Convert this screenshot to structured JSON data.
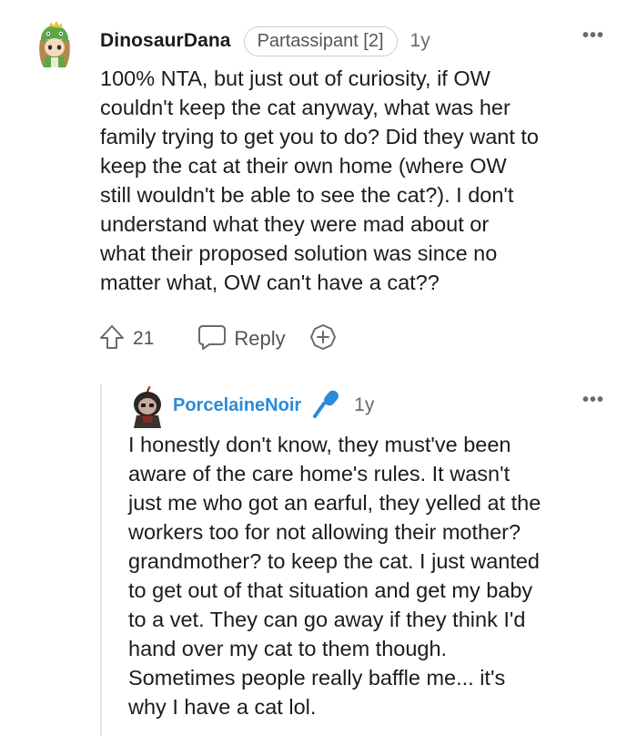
{
  "comment": {
    "username": "DinosaurDana",
    "flair": "Partassipant [2]",
    "age": "1y",
    "more": "•••",
    "body": "100% NTA, but just out of curiosity, if OW\ncouldn't keep the cat anyway, what was her\nfamily trying to get you to do? Did they want to\nkeep the cat at their own home (where OW\nstill wouldn't be able to see the cat?). I don't\nunderstand what they were mad about or\nwhat their proposed solution was since no\nmatter what, OW can't have a cat??",
    "upvotes": "21",
    "reply_label": "Reply",
    "icons": {
      "upvote": "upvote-arrow-icon",
      "reply": "speech-bubble-icon",
      "award": "plus-award-icon"
    }
  },
  "reply": {
    "username": "PorcelaineNoir",
    "age": "1y",
    "more": "•••",
    "body": "I honestly don't know, they must've been\naware of the care home's rules. It wasn't\njust me who got an earful, they yelled at the\nworkers too for not allowing their mother?\ngrandmother? to keep the cat. I just wanted\nto get out of that situation and get my baby\nto a vet. They can go away if they think I'd\nhand over my cat to them though.\nSometimes people really baffle me... it's\nwhy I have a cat lol.",
    "icons": {
      "mic": "microphone-icon"
    }
  },
  "colors": {
    "reply_username": "#2b8ad8",
    "text": "#1c1c1c",
    "muted": "#555555",
    "thread_line": "#e4e4e4"
  }
}
